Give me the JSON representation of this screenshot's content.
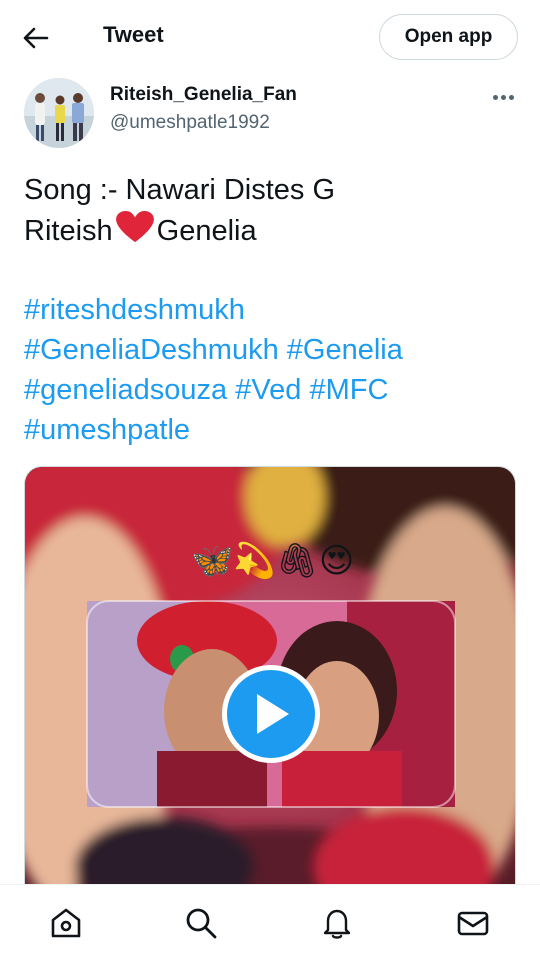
{
  "header": {
    "back_icon": "arrow-left-icon",
    "title": "Tweet",
    "open_app_label": "Open app"
  },
  "author": {
    "name": "Riteish_Genelia_Fan",
    "handle": "@umeshpatle1992",
    "more_icon": "more-horizontal-icon"
  },
  "tweet": {
    "line1": "Song :- Nawari Distes G",
    "line2_before": "Riteish",
    "line2_after": "Genelia",
    "heart_icon": "red-heart-emoji",
    "hashtag_lines": [
      [
        "#riteshdeshmukh"
      ],
      [
        "#GeneliaDeshmukh",
        "#Genelia"
      ],
      [
        "#geneliadsouza",
        "#Ved",
        "#MFC"
      ],
      [
        "#umeshpatle"
      ]
    ]
  },
  "media": {
    "emoji_row": "🦋💫🖇😍",
    "play_icon": "play-icon"
  },
  "bottom_nav": {
    "items": [
      "home-icon",
      "search-icon",
      "notifications-icon",
      "messages-icon"
    ]
  },
  "colors": {
    "accent": "#1d9bf0",
    "text": "#0f1419",
    "secondary_text": "#536471",
    "border": "#cfd9de"
  }
}
